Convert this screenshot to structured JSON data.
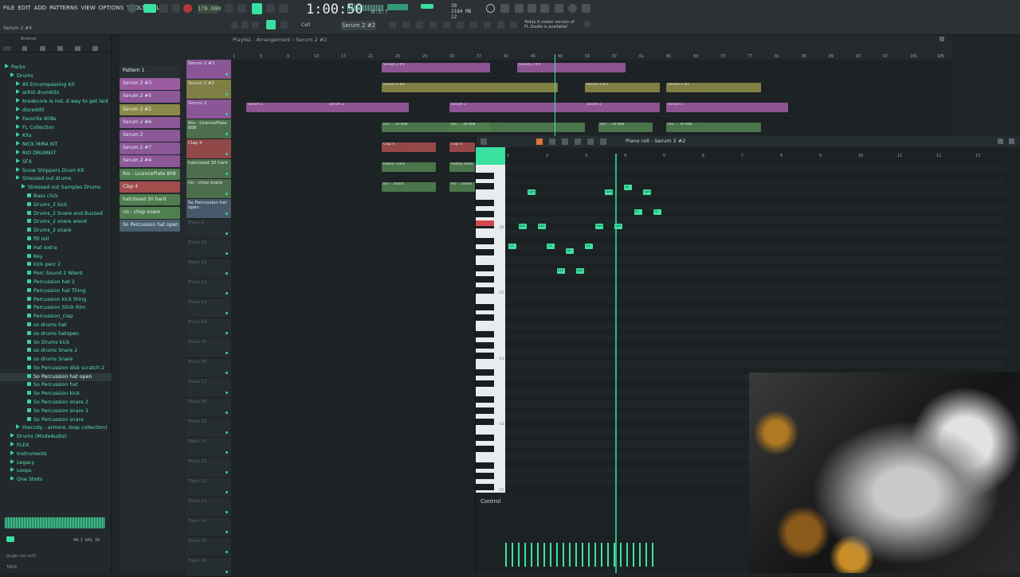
{
  "menu": [
    "FILE",
    "EDIT",
    "ADD",
    "PATTERNS",
    "VIEW",
    "OPTIONS",
    "TOOLS",
    "HELP"
  ],
  "pattern_name": "Serum 2 #4",
  "tempo": "170.000",
  "time": {
    "main": "1:00:50",
    "sub": "B:S:T"
  },
  "song_meta": {
    "line1": "38",
    "line2": "2184 MB",
    "line3": "12"
  },
  "current_pattern": "Serum 2 #2",
  "snap": "Cell",
  "notice": {
    "line1": "Today  A newer version of",
    "line2": "FL Studio is available!"
  },
  "browser": {
    "title": "Browser",
    "items": [
      {
        "label": "Packs",
        "type": "folder",
        "indent": 0
      },
      {
        "label": "Drums",
        "type": "folder",
        "indent": 1
      },
      {
        "label": "All Encompassing Kit",
        "type": "folder",
        "indent": 2
      },
      {
        "label": "artist drumkits",
        "type": "folder",
        "indent": 2
      },
      {
        "label": "breakcore is not..d way to get laid",
        "type": "folder",
        "indent": 2
      },
      {
        "label": "disreddit",
        "type": "folder",
        "indent": 2
      },
      {
        "label": "Favorite 808s",
        "type": "folder",
        "indent": 2
      },
      {
        "label": "FL Collection",
        "type": "folder",
        "indent": 2
      },
      {
        "label": "Kits",
        "type": "folder",
        "indent": 2
      },
      {
        "label": "NICK MIRA KIT",
        "type": "folder",
        "indent": 2
      },
      {
        "label": "RIO DRUMKIT",
        "type": "folder",
        "indent": 2
      },
      {
        "label": "SFX",
        "type": "folder",
        "indent": 2
      },
      {
        "label": "Snow Strippers Drum Kit",
        "type": "folder",
        "indent": 2
      },
      {
        "label": "Stressed out drums",
        "type": "folder",
        "indent": 2
      },
      {
        "label": "Stressed out Samples Drums",
        "type": "folder",
        "indent": 3
      },
      {
        "label": "Bass click",
        "type": "file",
        "indent": 4
      },
      {
        "label": "Drums_2 kick",
        "type": "file",
        "indent": 4
      },
      {
        "label": "Drums_2 Snare end Buzzed",
        "type": "file",
        "indent": 4
      },
      {
        "label": "Drums_2 snare wierd",
        "type": "file",
        "indent": 4
      },
      {
        "label": "Drums_2 snare",
        "type": "file",
        "indent": 4
      },
      {
        "label": "fill roll",
        "type": "file",
        "indent": 4
      },
      {
        "label": "Hat extra",
        "type": "file",
        "indent": 4
      },
      {
        "label": "Key",
        "type": "file",
        "indent": 4
      },
      {
        "label": "kick perc 2",
        "type": "file",
        "indent": 4
      },
      {
        "label": "Perc Sound 2 Wierd",
        "type": "file",
        "indent": 4
      },
      {
        "label": "Percussion hat 2",
        "type": "file",
        "indent": 4
      },
      {
        "label": "Percussion hat Thing",
        "type": "file",
        "indent": 4
      },
      {
        "label": "Percussion kick thing",
        "type": "file",
        "indent": 4
      },
      {
        "label": "Percussion Stick Rim",
        "type": "file",
        "indent": 4
      },
      {
        "label": "Percussion_clap",
        "type": "file",
        "indent": 4
      },
      {
        "label": "so drums hat",
        "type": "file",
        "indent": 4
      },
      {
        "label": "so drums hatopen",
        "type": "file",
        "indent": 4
      },
      {
        "label": "So Drums kick",
        "type": "file",
        "indent": 4
      },
      {
        "label": "so drums Snare 2",
        "type": "file",
        "indent": 4
      },
      {
        "label": "so drums Snare",
        "type": "file",
        "indent": 4
      },
      {
        "label": "So Percussion disk scratch 2",
        "type": "file",
        "indent": 4
      },
      {
        "label": "So Percussion hat open",
        "type": "file",
        "indent": 4,
        "selected": true
      },
      {
        "label": "So Percussion hat",
        "type": "file",
        "indent": 4
      },
      {
        "label": "So Percussion kick",
        "type": "file",
        "indent": 4
      },
      {
        "label": "So Percussion snare 2",
        "type": "file",
        "indent": 4
      },
      {
        "label": "So Percussion snare 3",
        "type": "file",
        "indent": 4
      },
      {
        "label": "So Percussion snare",
        "type": "file",
        "indent": 4
      },
      {
        "label": "thecndy - armore..loop collection)",
        "type": "folder",
        "indent": 2
      },
      {
        "label": "Drums (ModeAudio)",
        "type": "folder",
        "indent": 1
      },
      {
        "label": "FLEX",
        "type": "folder",
        "indent": 1
      },
      {
        "label": "Instruments",
        "type": "folder",
        "indent": 1
      },
      {
        "label": "Legacy",
        "type": "folder",
        "indent": 1
      },
      {
        "label": "Loops",
        "type": "folder",
        "indent": 1
      },
      {
        "label": "One Shots",
        "type": "folder",
        "indent": 1
      }
    ],
    "sample_info": "44.1 kHz 16",
    "tags_label": "plugin  vst  vst3",
    "tags_footer": "TAGS"
  },
  "playlist": {
    "title": "Playlist - Arrangement › Serum 2 #2",
    "picker": [
      {
        "label": "Pattern 1",
        "color": "#2a3134"
      },
      {
        "label": "Serum 2 #3",
        "color": "#9a5aa0"
      },
      {
        "label": "Serum 2 #5",
        "color": "#8c5898"
      },
      {
        "label": "Serum 2 #2",
        "color": "#8a8a48"
      },
      {
        "label": "Serum 2 #6",
        "color": "#8c5898"
      },
      {
        "label": "Serum 2",
        "color": "#8c5898"
      },
      {
        "label": "Serum 2 #7",
        "color": "#8c5898"
      },
      {
        "label": "Serum 2 #4",
        "color": "#8c5898"
      },
      {
        "label": "Rio - LicencePlate 808",
        "color": "#4f7f4f"
      },
      {
        "label": "Clap 4",
        "color": "#a24c4c"
      },
      {
        "label": "hatclosed 30 hard",
        "color": "#4f7f4f"
      },
      {
        "label": "rio - chop snare",
        "color": "#4f7f4f"
      },
      {
        "label": "So Percussion hat open",
        "color": "#49606e"
      }
    ],
    "tracks": [
      {
        "label": "Serum 2 #3",
        "color": "#8a5696"
      },
      {
        "label": "Serum 2 #2",
        "color": "#7f7f45"
      },
      {
        "label": "Serum 2",
        "color": "#8a5696"
      },
      {
        "label": "Rio - LicencePlate 808",
        "color": "#4d6e4d"
      },
      {
        "label": "Clap 4",
        "color": "#914848"
      },
      {
        "label": "hatclosed 30 hard",
        "color": "#4d6e4d"
      },
      {
        "label": "rio - chop snare",
        "color": "#4d6e4d"
      },
      {
        "label": "So Percussion hat open",
        "color": "#45596a"
      },
      {
        "label": "Track 9",
        "color": ""
      },
      {
        "label": "Track 10",
        "color": ""
      },
      {
        "label": "Track 11",
        "color": ""
      },
      {
        "label": "Track 12",
        "color": ""
      },
      {
        "label": "Track 13",
        "color": ""
      },
      {
        "label": "Track 14",
        "color": ""
      },
      {
        "label": "Track 15",
        "color": ""
      },
      {
        "label": "Track 16",
        "color": ""
      },
      {
        "label": "Track 17",
        "color": ""
      },
      {
        "label": "Track 18",
        "color": ""
      },
      {
        "label": "Track 19",
        "color": ""
      },
      {
        "label": "Track 20",
        "color": ""
      },
      {
        "label": "Track 21",
        "color": ""
      },
      {
        "label": "Track 22",
        "color": ""
      },
      {
        "label": "Track 23",
        "color": ""
      },
      {
        "label": "Track 24",
        "color": ""
      },
      {
        "label": "Track 25",
        "color": ""
      },
      {
        "label": "Track 26",
        "color": ""
      }
    ],
    "ruler": [
      "1",
      "5",
      "9",
      "13",
      "17",
      "21",
      "25",
      "29",
      "33",
      "37",
      "41",
      "45",
      "49",
      "53",
      "57",
      "61",
      "65",
      "69",
      "73",
      "77",
      "81",
      "85",
      "89",
      "93",
      "97",
      "101",
      "105"
    ],
    "clips": [
      {
        "track": 0,
        "start": 34,
        "len": 16,
        "label": "Serum 2 #3",
        "color": "#9a5aa0"
      },
      {
        "track": 0,
        "start": 54,
        "len": 16,
        "label": "Serum 2 #3",
        "color": "#9a5aa0"
      },
      {
        "track": 1,
        "start": 34,
        "len": 26,
        "label": "Serum 2 #2",
        "color": "#8a8a48"
      },
      {
        "track": 1,
        "start": 64,
        "len": 11,
        "label": "Serum 2 #2",
        "color": "#8a8a48"
      },
      {
        "track": 1,
        "start": 76,
        "len": 14,
        "label": "Serum 2 #2",
        "color": "#8a8a48"
      },
      {
        "track": 2,
        "start": 14,
        "len": 12,
        "label": "Serum 2",
        "color": "#9a5aa0"
      },
      {
        "track": 2,
        "start": 26,
        "len": 12,
        "label": "Serum 2",
        "color": "#9a5aa0"
      },
      {
        "track": 2,
        "start": 44,
        "len": 20,
        "label": "Serum 2",
        "color": "#9a5aa0"
      },
      {
        "track": 2,
        "start": 64,
        "len": 11,
        "label": "Serum 2",
        "color": "#9a5aa0"
      },
      {
        "track": 2,
        "start": 76,
        "len": 18,
        "label": "Serum 2",
        "color": "#9a5aa0"
      },
      {
        "track": 3,
        "start": 34,
        "len": 16,
        "label": "Rio - ...te 808",
        "color": "#4f7f4f"
      },
      {
        "track": 3,
        "start": 44,
        "len": 20,
        "label": "Rio - ...te 808",
        "color": "#4f7f4f"
      },
      {
        "track": 3,
        "start": 66,
        "len": 8,
        "label": "Rio - ...te 808",
        "color": "#4f7f4f"
      },
      {
        "track": 3,
        "start": 76,
        "len": 14,
        "label": "Rio - ...te 808",
        "color": "#4f7f4f"
      },
      {
        "track": 4,
        "start": 34,
        "len": 8,
        "label": "Clap 4",
        "color": "#a24c4c"
      },
      {
        "track": 4,
        "start": 44,
        "len": 16,
        "label": "Clap 4",
        "color": "#a24c4c"
      },
      {
        "track": 5,
        "start": 34,
        "len": 8,
        "label": "hatclo..hard",
        "color": "#4f7f4f"
      },
      {
        "track": 5,
        "start": 44,
        "len": 8,
        "label": "hatclo..hard",
        "color": "#4f7f4f"
      },
      {
        "track": 6,
        "start": 34,
        "len": 8,
        "label": "rio - ..snare",
        "color": "#4f7f4f"
      },
      {
        "track": 6,
        "start": 44,
        "len": 16,
        "label": "rio - ..snare",
        "color": "#4f7f4f"
      }
    ]
  },
  "piano_roll": {
    "title": "Piano roll - Serum 2 #2",
    "ruler": [
      "1",
      "2",
      "3",
      "4",
      "5",
      "6",
      "7",
      "8",
      "9",
      "10",
      "11",
      "12",
      "13"
    ],
    "key_labels": [
      "C6",
      "C5",
      "C4",
      "C3",
      "C2"
    ],
    "notes": [
      {
        "bar": 1.58,
        "row": 5,
        "label": "G#5"
      },
      {
        "bar": 3.56,
        "row": 5,
        "label": "G#5"
      },
      {
        "bar": 4.05,
        "row": 4,
        "label": "A5"
      },
      {
        "bar": 4.54,
        "row": 5,
        "label": "G#5"
      },
      {
        "bar": 4.3,
        "row": 9,
        "label": "F5"
      },
      {
        "bar": 4.79,
        "row": 9,
        "label": "F5"
      },
      {
        "bar": 1.34,
        "row": 12,
        "label": "D#5"
      },
      {
        "bar": 1.83,
        "row": 12,
        "label": "D#5"
      },
      {
        "bar": 3.31,
        "row": 12,
        "label": "D#5"
      },
      {
        "bar": 3.8,
        "row": 12,
        "label": "D#5"
      },
      {
        "bar": 1.09,
        "row": 16,
        "label": "C5"
      },
      {
        "bar": 2.07,
        "row": 16,
        "label": "C5"
      },
      {
        "bar": 2.56,
        "row": 17,
        "label": "B4"
      },
      {
        "bar": 3.05,
        "row": 16,
        "label": "C5"
      },
      {
        "bar": 2.32,
        "row": 21,
        "label": "A#4"
      },
      {
        "bar": 2.81,
        "row": 21,
        "label": "A#4"
      }
    ],
    "control_label": "Control",
    "velocity_bars": 24
  },
  "colors": {
    "accent": "#39e0a0",
    "background": "#1f2427"
  }
}
